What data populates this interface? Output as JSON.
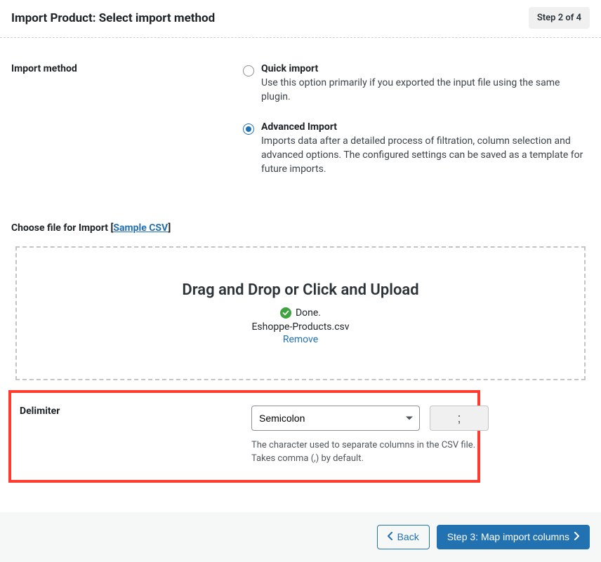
{
  "header": {
    "title": "Import Product: Select import method",
    "step_badge": "Step 2 of 4"
  },
  "import_method": {
    "label": "Import method",
    "options": [
      {
        "title": "Quick import",
        "desc": "Use this option primarily if you exported the input file using the same plugin.",
        "selected": false
      },
      {
        "title": "Advanced Import",
        "desc": "Imports data after a detailed process of filtration, column selection and advanced options. The configured settings can be saved as a template for future imports.",
        "selected": true
      }
    ]
  },
  "choose_file": {
    "label": "Choose file for Import",
    "sample_link": "Sample CSV",
    "dropzone_title": "Drag and Drop or Click and Upload",
    "done_text": "Done.",
    "filename": "Eshoppe-Products.csv",
    "remove_text": "Remove"
  },
  "delimiter": {
    "label": "Delimiter",
    "selected": "Semicolon",
    "char": ";",
    "help_text": "The character used to separate columns in the CSV file. Takes comma (,) by default."
  },
  "footer": {
    "back_label": "Back",
    "next_label": "Step 3: Map import columns"
  }
}
